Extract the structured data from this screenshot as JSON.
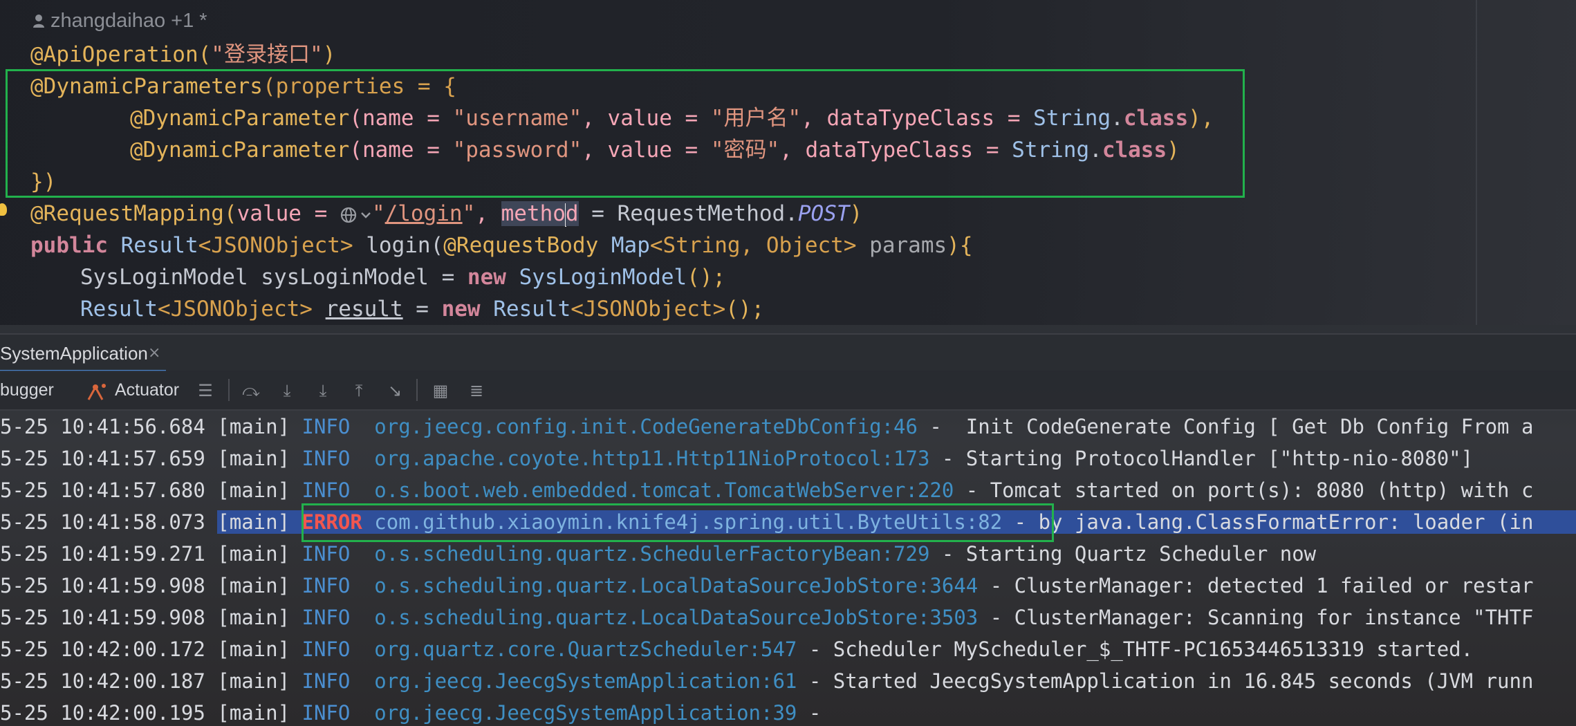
{
  "editor": {
    "author_hint": "zhangdaihao +1 *",
    "lines": {
      "l1_ann": "@ApiOperation(",
      "l1_str": "\"登录接口\"",
      "l1_end": ")",
      "l2_ann": "@DynamicParameters",
      "l2_rest": "(properties = {",
      "l3_ann": "@DynamicParameter",
      "l3_a": "(name = ",
      "l3_name": "\"username\"",
      "l3_b": ", value = ",
      "l3_value": "\"用户名\"",
      "l3_c": ", dataTypeClass = ",
      "l3_cls": "String",
      "l3_d": ".",
      "l3_kw": "class",
      "l3_e": "),",
      "l4_ann": "@DynamicParameter",
      "l4_a": "(name = ",
      "l4_name": "\"password\"",
      "l4_b": ", value = ",
      "l4_value": "\"密码\"",
      "l4_c": ", dataTypeClass = ",
      "l4_cls": "String",
      "l4_d": ".",
      "l4_kw": "class",
      "l4_e": ")",
      "l5": "})",
      "l6_ann": "@RequestMapping(",
      "l6_a": "value = ",
      "l6_q1": "\"",
      "l6_path": "/login",
      "l6_q2": "\"",
      "l6_b": ", ",
      "l6_method_a": "metho",
      "l6_method_b": "d",
      "l6_c": " = RequestMethod.",
      "l6_post": "POST",
      "l6_end": ")",
      "l7_kw": "public",
      "l7_a": " Result",
      "l7_b": "<JSONObject>",
      "l7_c": " login(",
      "l7_ann": "@RequestBody",
      "l7_d": " Map",
      "l7_e": "<String, Object>",
      "l7_f": " params",
      "l7_g": "){",
      "l8_a": "SysLoginModel sysLoginModel = ",
      "l8_kw": "new",
      "l8_b": " SysLoginModel",
      "l8_c": "();",
      "l9_a": "Result",
      "l9_b": "<JSONObject>",
      "l9_var": "result",
      "l9_c": " = ",
      "l9_kw": "new",
      "l9_d": " Result",
      "l9_e": "<JSONObject>",
      "l9_f": "();"
    }
  },
  "tool_window": {
    "tab_label": "SystemApplication",
    "tab_close": "×",
    "debugger_label": "bugger",
    "actuator_label": "Actuator"
  },
  "console": {
    "rows": [
      {
        "ts": "5-25 10:41:56.684",
        "thread": "[main]",
        "level": "INFO",
        "logger": "org.jeecg.config.init.CodeGenerateDbConfig:46",
        "msg": " -  Init CodeGenerate Config [ Get Db Config From a"
      },
      {
        "ts": "5-25 10:41:57.659",
        "thread": "[main]",
        "level": "INFO",
        "logger": "org.apache.coyote.http11.Http11NioProtocol:173",
        "msg": " - Starting ProtocolHandler [\"http-nio-8080\"]"
      },
      {
        "ts": "5-25 10:41:57.680",
        "thread": "[main]",
        "level": "INFO",
        "logger": "o.s.boot.web.embedded.tomcat.TomcatWebServer:220",
        "msg": " - Tomcat started on port(s): 8080 (http) with c"
      },
      {
        "ts": "5-25 10:41:58.073",
        "thread": "[main]",
        "level": "ERROR",
        "logger": "com.github.xiaoymin.knife4j.spring.util.ByteUtils:82",
        "msg": " - by java.lang.ClassFormatError: loader (in"
      },
      {
        "ts": "5-25 10:41:59.271",
        "thread": "[main]",
        "level": "INFO",
        "logger": "o.s.scheduling.quartz.SchedulerFactoryBean:729",
        "msg": " - Starting Quartz Scheduler now"
      },
      {
        "ts": "5-25 10:41:59.908",
        "thread": "[main]",
        "level": "INFO",
        "logger": "o.s.scheduling.quartz.LocalDataSourceJobStore:3644",
        "msg": " - ClusterManager: detected 1 failed or restar"
      },
      {
        "ts": "5-25 10:41:59.908",
        "thread": "[main]",
        "level": "INFO",
        "logger": "o.s.scheduling.quartz.LocalDataSourceJobStore:3503",
        "msg": " - ClusterManager: Scanning for instance \"THTF"
      },
      {
        "ts": "5-25 10:42:00.172",
        "thread": "[main]",
        "level": "INFO",
        "logger": "org.quartz.core.QuartzScheduler:547",
        "msg": " - Scheduler MyScheduler_$_THTF-PC1653446513319 started."
      },
      {
        "ts": "5-25 10:42:00.187",
        "thread": "[main]",
        "level": "INFO",
        "logger": "org.jeecg.JeecgSystemApplication:61",
        "msg": " - Started JeecgSystemApplication in 16.845 seconds (JVM runn"
      },
      {
        "ts": "5-25 10:42:00.195",
        "thread": "[main]",
        "level": "INFO",
        "logger": "org.jeecg.JeecgSystemApplication:39",
        "msg": " -"
      }
    ]
  },
  "colors": {
    "highlight_box": "#22b14c",
    "selection": "#2f4f9a",
    "error": "#f2564f",
    "info": "#4b8fd1"
  }
}
